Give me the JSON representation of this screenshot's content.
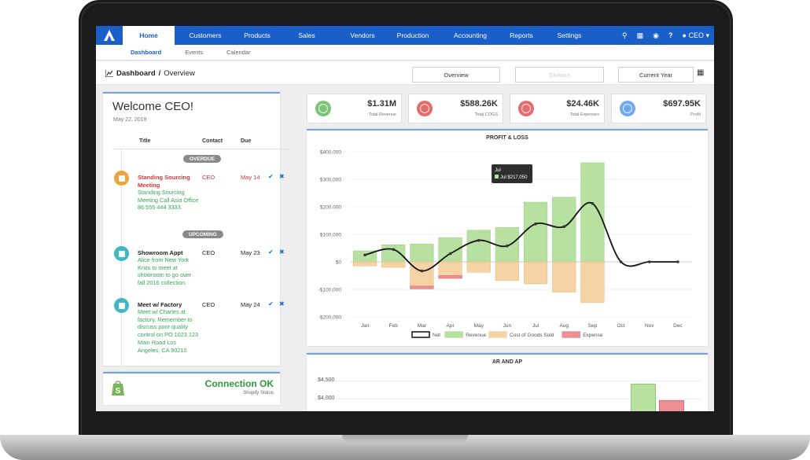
{
  "nav": {
    "items": [
      "Home",
      "Customers",
      "Products",
      "Sales",
      "Vendors",
      "Production",
      "Accounting",
      "Reports",
      "Settings"
    ],
    "user_label": "CEO"
  },
  "subnav": [
    "Dashboard",
    "Events",
    "Calendar"
  ],
  "breadcrumb": {
    "title": "Dashboard",
    "sep": "/",
    "page": "Overview"
  },
  "filters": {
    "view": "Overview",
    "division": "Division",
    "period": "Current Year"
  },
  "welcome": {
    "title": "Welcome CEO!",
    "date": "May 22, 2019",
    "headers": {
      "title": "Title",
      "contact": "Contact",
      "due": "Due"
    },
    "sections": {
      "overdue": "OVERDUE",
      "upcoming": "UPCOMING"
    },
    "events": [
      {
        "title": "Standing Sourcing Meeting",
        "desc": "Standing Sourcing Meeting Call Asia Office 86 555 444 3333.",
        "contact": "CEO",
        "due": "May 14",
        "status": "overdue"
      },
      {
        "title": "Showroom Appt",
        "desc": "Alice from New York Knits to meet at showroom to go over fall 2016 collection.",
        "contact": "CEO",
        "due": "May 23",
        "status": "upcoming"
      },
      {
        "title": "Meet w/ Factory",
        "desc": "Meet w/ Charles at factory. Remember to discuss poor quality control on PO 1023 123 Main Road Los Angeles, CA 90210",
        "contact": "CEO",
        "due": "May 24",
        "status": "upcoming"
      }
    ]
  },
  "shopify": {
    "status": "Connection OK",
    "label": "Shopify Status"
  },
  "kpis": [
    {
      "value": "$1.31M",
      "label": "Total Revenue",
      "color": "#7cc47a"
    },
    {
      "value": "$588.26K",
      "label": "Total COGS",
      "color": "#e46c6c"
    },
    {
      "value": "$24.46K",
      "label": "Total Expenses",
      "color": "#e46c6c"
    },
    {
      "value": "$697.95K",
      "label": "Profit",
      "color": "#6fa8ec"
    }
  ],
  "colors": {
    "nav": "#1a5ec8",
    "revenue": "#b8e0a0",
    "cogs": "#f5d3a5",
    "expense": "#ee8f93",
    "overdue": "#d63838",
    "desc": "#32a852"
  },
  "chart_data": {
    "type": "bar",
    "title": "PROFIT & LOSS",
    "categories": [
      "Jan",
      "Feb",
      "Mar",
      "Apr",
      "May",
      "Jun",
      "Jul",
      "Aug",
      "Sep",
      "Oct",
      "Nov",
      "Dec"
    ],
    "ylim": [
      -200000,
      400000
    ],
    "yticks": [
      "$400,000",
      "$300,000",
      "$200,000",
      "$100,000",
      "$0",
      "-$100,000",
      "-$200,000"
    ],
    "series": [
      {
        "name": "Revenue",
        "values": [
          40000,
          62000,
          65000,
          88000,
          115000,
          125000,
          217050,
          235000,
          360000,
          0,
          0,
          0
        ]
      },
      {
        "name": "Cost of Goods Sold",
        "values": [
          -15000,
          -20000,
          -88000,
          -50000,
          -38000,
          -68000,
          -80000,
          -110000,
          -148000,
          0,
          0,
          0
        ]
      },
      {
        "name": "Expense",
        "values": [
          0,
          0,
          -10000,
          -10000,
          0,
          0,
          0,
          0,
          0,
          0,
          0,
          0
        ]
      },
      {
        "name": "Net",
        "values": [
          25000,
          45000,
          -33000,
          30000,
          78000,
          58000,
          138000,
          128000,
          212000,
          0,
          0,
          0
        ]
      }
    ],
    "tooltip": {
      "title": "Jul",
      "text": "Jul $217,050"
    },
    "legend": [
      "Net",
      "Revenue",
      "Cost of Goods Sold",
      "Expense"
    ]
  },
  "ar_chart": {
    "title": "AR AND AP",
    "yticks": [
      "$4,500",
      "$4,000"
    ]
  }
}
